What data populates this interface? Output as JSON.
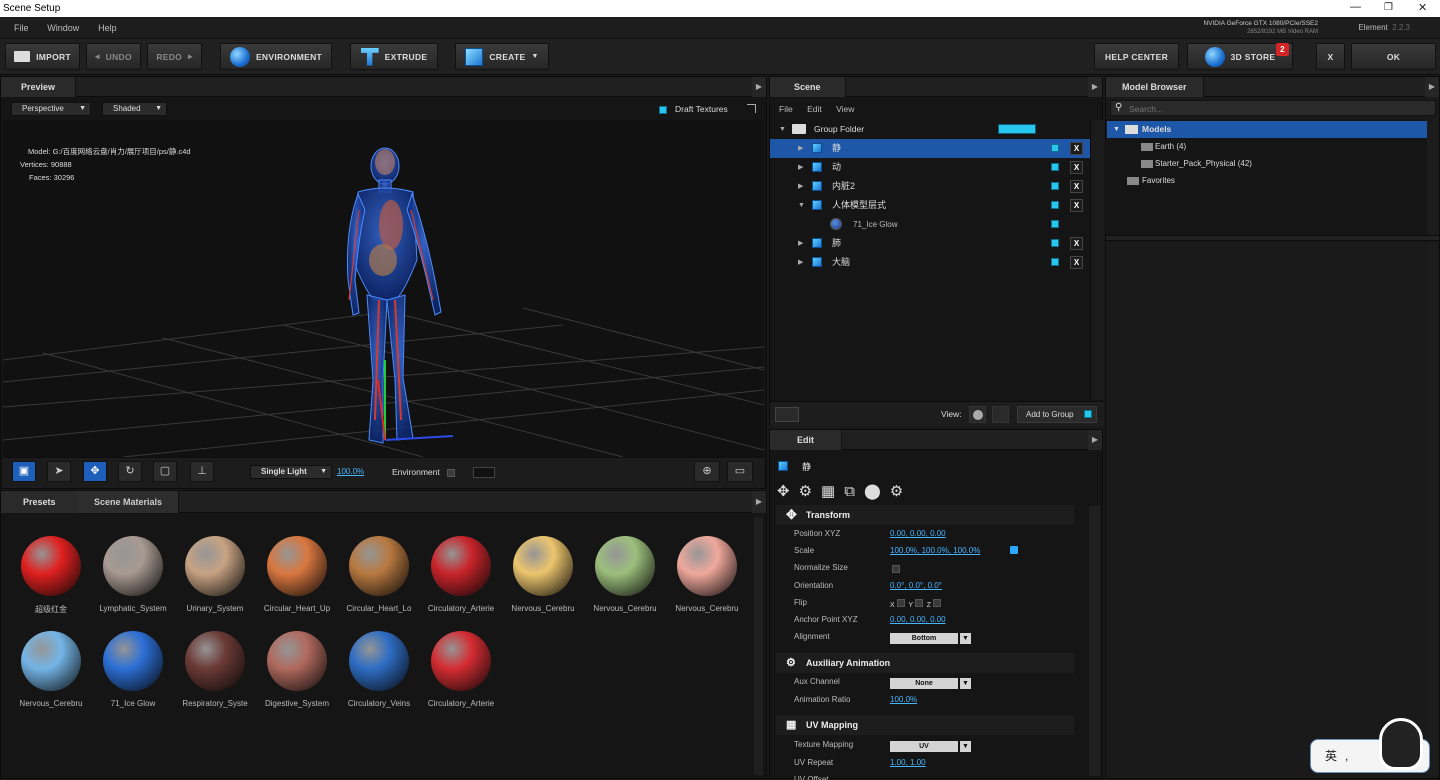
{
  "window": {
    "title": "Scene Setup",
    "min": "—",
    "restore": "❐",
    "close": "✕"
  },
  "menu": [
    "File",
    "Window",
    "Help"
  ],
  "gpu": {
    "line1": "NVIDIA GeForce GTX 1080/PCIe/SSE2",
    "line2": "2852/8192 MB Video RAM"
  },
  "app": {
    "name": "Element",
    "version": "2.2.3"
  },
  "toolbar": {
    "import": "IMPORT",
    "undo": "UNDO",
    "redo": "REDO",
    "environment": "ENVIRONMENT",
    "extrude": "EXTRUDE",
    "create": "CREATE",
    "help": "HELP CENTER",
    "store": "3D STORE",
    "store_badge": "2",
    "close": "X",
    "ok": "OK"
  },
  "preview": {
    "tab": "Preview",
    "camera": "Perspective",
    "shading": "Shaded",
    "draft": "Draft Textures",
    "info": [
      {
        "k": "Model:",
        "v": "G:/百度网络云盘/肖力/展厅项目/ps/静.c4d"
      },
      {
        "k": "Vertices:",
        "v": "90888"
      },
      {
        "k": "Faces:",
        "v": "30296"
      }
    ],
    "light": "Single Light",
    "light_pct": "100.0%",
    "environment": "Environment"
  },
  "scene": {
    "tab": "Scene",
    "menu": [
      "File",
      "Edit",
      "View"
    ],
    "group": "Group Folder",
    "items": [
      {
        "name": "静",
        "level": 1,
        "sel": true
      },
      {
        "name": "动",
        "level": 1
      },
      {
        "name": "内脏2",
        "level": 1
      },
      {
        "name": "人体模型层式",
        "level": 1,
        "open": true
      },
      {
        "name": "71_Ice Glow",
        "level": 2,
        "material": true
      },
      {
        "name": "肺",
        "level": 1
      },
      {
        "name": "大脑",
        "level": 1
      }
    ],
    "view_label": "View:",
    "add_group": "Add to Group"
  },
  "browser": {
    "tab": "Model Browser",
    "search_placeholder": "Search...",
    "root": "Models",
    "children": [
      "Earth (4)",
      "Starter_Pack_Physical (42)"
    ],
    "favorites": "Favorites"
  },
  "materials": {
    "tabs": [
      "Presets",
      "Scene Materials"
    ],
    "items": [
      {
        "name": "超级红金",
        "color": "#e02020"
      },
      {
        "name": "Lymphatic_System",
        "color": "#a89a92"
      },
      {
        "name": "Urinary_System",
        "color": "#c7a383"
      },
      {
        "name": "Circular_Heart_Up",
        "color": "#d9773f"
      },
      {
        "name": "Circular_Heart_Lo",
        "color": "#b87940"
      },
      {
        "name": "Circulatory_Arterie",
        "color": "#c8242a"
      },
      {
        "name": "Nervous_Cerebru",
        "color": "#ecc56d"
      },
      {
        "name": "Nervous_Cerebru",
        "color": "#9cbf7c"
      },
      {
        "name": "Nervous_Cerebru",
        "color": "#f0a89c"
      },
      {
        "name": "Nervous_Cerebru",
        "color": "#74b5e6"
      },
      {
        "name": "71_Ice Glow",
        "color": "#2c6fd6"
      },
      {
        "name": "Respiratory_Syste",
        "color": "#6b3a36"
      },
      {
        "name": "Digestive_System",
        "color": "#b0695e"
      },
      {
        "name": "Circulatory_Veins",
        "color": "#2e6dc4"
      },
      {
        "name": "Circulatory_Arterie",
        "color": "#d42c32"
      }
    ]
  },
  "edit": {
    "tab": "Edit",
    "object": "静",
    "transform": {
      "title": "Transform",
      "pos_label": "Position XYZ",
      "pos": [
        "0.00",
        "0.00",
        "0.00"
      ],
      "scale_label": "Scale",
      "scale": [
        "100.0%",
        "100.0%",
        "100.0%"
      ],
      "normalize": "Normalize Size",
      "orient_label": "Orientation",
      "orient": [
        "0.0°",
        "0.0°",
        "0.0°"
      ],
      "flip_label": "Flip",
      "anchor_label": "Anchor Point XYZ",
      "anchor": [
        "0.00",
        "0.00",
        "0.00"
      ],
      "align_label": "Alignment",
      "align": "Bottom"
    },
    "aux": {
      "title": "Auxiliary Animation",
      "channel_label": "Aux Channel",
      "channel": "None",
      "ratio_label": "Animation Ratio",
      "ratio": "100.0%"
    },
    "uv": {
      "title": "UV Mapping",
      "tex_label": "Texture Mapping",
      "tex": "UV",
      "repeat_label": "UV Repeat",
      "repeat": [
        "1.00",
        "1.00"
      ],
      "offset_label": "UV Offset"
    }
  },
  "ime": {
    "text": "英"
  }
}
